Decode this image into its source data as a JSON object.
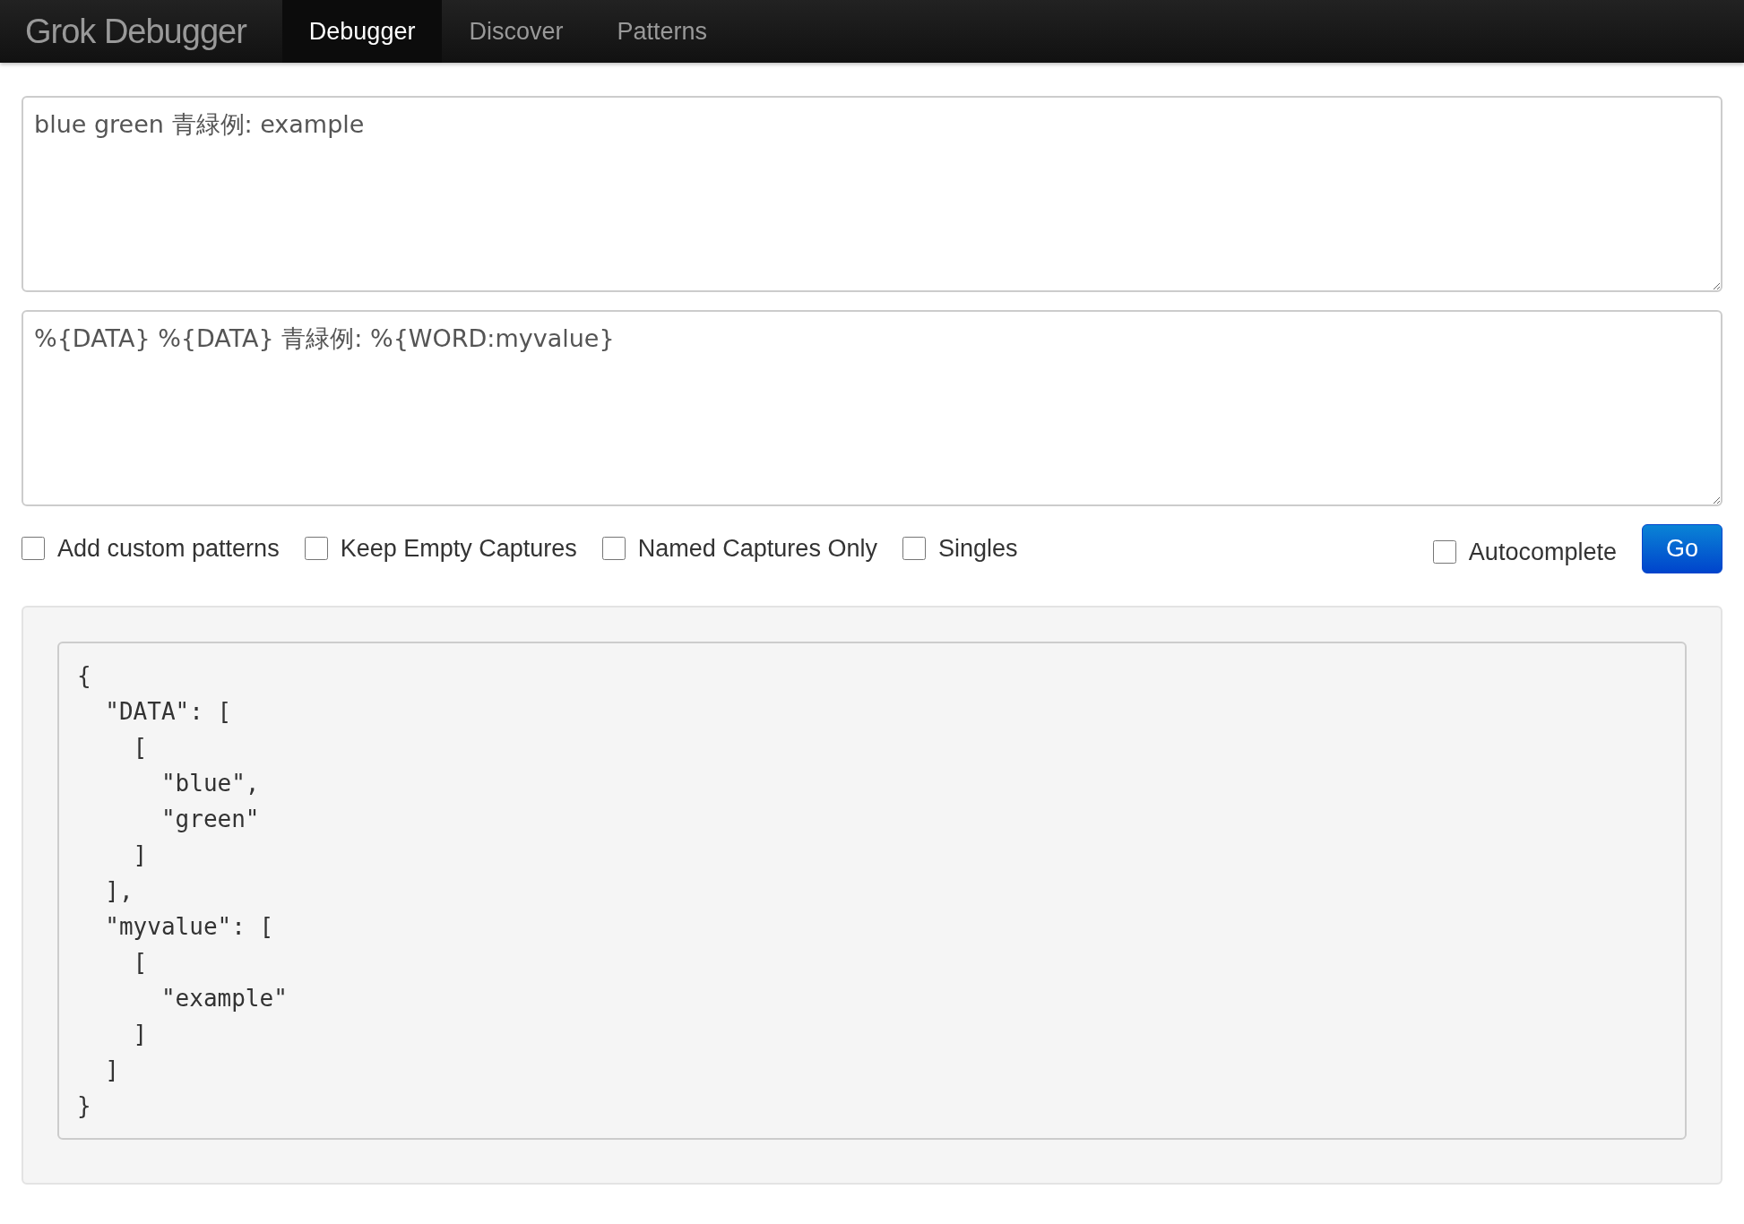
{
  "navbar": {
    "brand": "Grok Debugger",
    "items": [
      {
        "label": "Debugger",
        "selected": true
      },
      {
        "label": "Discover",
        "selected": false
      },
      {
        "label": "Patterns",
        "selected": false
      }
    ]
  },
  "input_text": {
    "value": "blue green 青緑例: example"
  },
  "pattern": {
    "value": "%{DATA} %{DATA} 青緑例: %{WORD:myvalue}"
  },
  "options": [
    {
      "label": "Add custom patterns",
      "checked": false
    },
    {
      "label": "Keep Empty Captures",
      "checked": false
    },
    {
      "label": "Named Captures Only",
      "checked": false
    },
    {
      "label": "Singles",
      "checked": false
    }
  ],
  "autocomplete": {
    "label": "Autocomplete",
    "checked": false
  },
  "go_button": "Go",
  "output": "{\n  \"DATA\": [\n    [\n      \"blue\",\n      \"green\"\n    ]\n  ],\n  \"myvalue\": [\n    [\n      \"example\"\n    ]\n  ]\n}"
}
